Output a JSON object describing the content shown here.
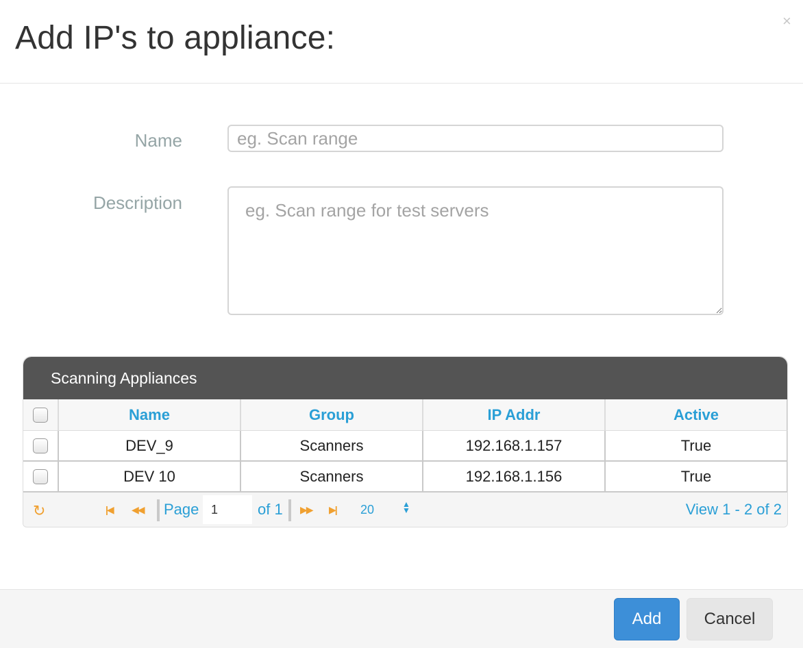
{
  "modal": {
    "title": "Add IP's to appliance:",
    "close_glyph": "×"
  },
  "form": {
    "name_label": "Name",
    "name_placeholder": "eg. Scan range",
    "name_value": "",
    "description_label": "Description",
    "description_placeholder": "eg. Scan range for test servers",
    "description_value": ""
  },
  "grid": {
    "caption": "Scanning Appliances",
    "columns": [
      "Name",
      "Group",
      "IP Addr",
      "Active"
    ],
    "rows": [
      {
        "name": "DEV_9",
        "group": "Scanners",
        "ip": "192.168.1.157",
        "active": "True",
        "checked": false
      },
      {
        "name": "DEV 10",
        "group": "Scanners",
        "ip": "192.168.1.156",
        "active": "True",
        "checked": false
      }
    ],
    "pager": {
      "page_label": "Page",
      "page_value": "1",
      "of_text": "of 1",
      "page_size": "20",
      "view_text": "View 1 - 2 of 2"
    }
  },
  "footer": {
    "add_label": "Add",
    "cancel_label": "Cancel"
  },
  "colors": {
    "accent": "#2a9fd6",
    "primary_button": "#3d8fd8",
    "caption_bg": "#545454",
    "pager_icon": "#f0a030",
    "label": "#95a5a6"
  },
  "icons": {
    "close": "close-icon",
    "refresh": "refresh-icon",
    "first_page": "first-page-icon",
    "prev_page": "prev-page-icon",
    "next_page": "next-page-icon",
    "last_page": "last-page-icon",
    "page_size_select": "select-arrows-icon"
  }
}
